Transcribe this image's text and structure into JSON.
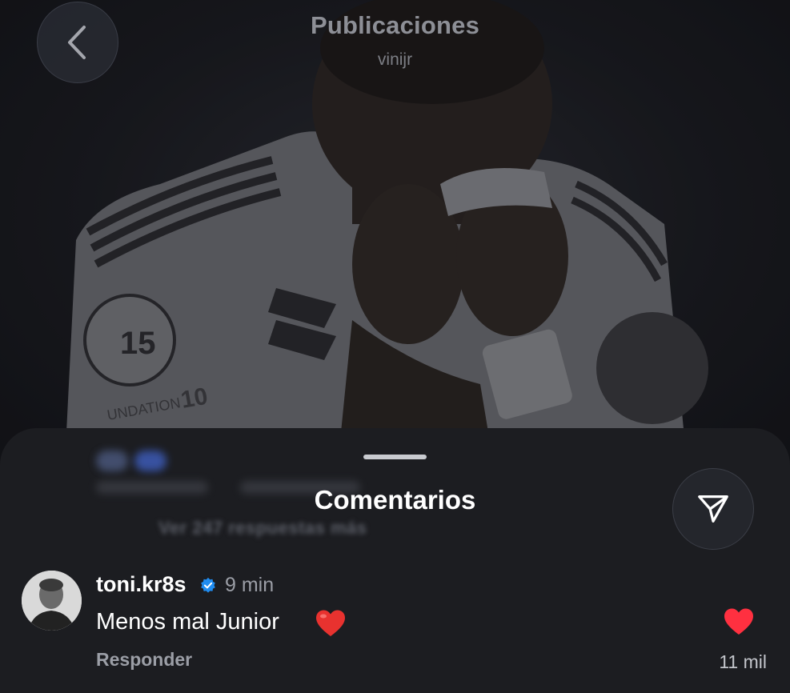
{
  "header": {
    "title": "Publicaciones",
    "subtitle": "vinijr",
    "back_icon": "chevron-left-icon"
  },
  "photo": {
    "jersey_badge_number": "15",
    "sleeve_text": "UNDATION",
    "sleeve_number": "10"
  },
  "comments_sheet": {
    "title": "Comentarios",
    "share_icon": "send-icon",
    "blurred_view_more": "Ver 247 respuestas más",
    "comment": {
      "username": "toni.kr8s",
      "verified": true,
      "time": "9 min",
      "text": "Menos mal Junior",
      "emoji": "❤️",
      "reply_label": "Responder",
      "likes": "11 mil",
      "like_icon": "heart-icon",
      "like_color": "#ff3040"
    }
  }
}
